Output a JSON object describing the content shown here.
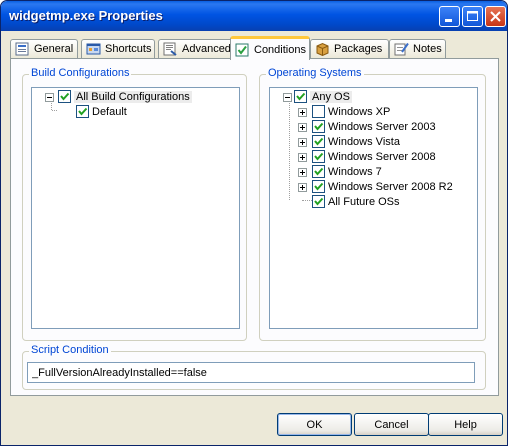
{
  "window": {
    "title": "widgetmp.exe Properties"
  },
  "tabs": [
    {
      "label": "General",
      "icon": "general-icon",
      "active": false
    },
    {
      "label": "Shortcuts",
      "icon": "shortcuts-icon",
      "active": false
    },
    {
      "label": "Advanced",
      "icon": "advanced-icon",
      "active": false
    },
    {
      "label": "Conditions",
      "icon": "conditions-icon",
      "active": true
    },
    {
      "label": "Packages",
      "icon": "packages-icon",
      "active": false
    },
    {
      "label": "Notes",
      "icon": "notes-icon",
      "active": false
    }
  ],
  "build_configurations": {
    "group_label": "Build Configurations",
    "root": {
      "label": "All Build Configurations",
      "checked": true,
      "expanded": true
    },
    "children": [
      {
        "label": "Default",
        "checked": true
      }
    ]
  },
  "operating_systems": {
    "group_label": "Operating Systems",
    "root": {
      "label": "Any OS",
      "checked": true,
      "expanded": true
    },
    "children": [
      {
        "label": "Windows XP",
        "checked": false,
        "expandable": true
      },
      {
        "label": "Windows Server 2003",
        "checked": true,
        "expandable": true
      },
      {
        "label": "Windows Vista",
        "checked": true,
        "expandable": true
      },
      {
        "label": "Windows Server 2008",
        "checked": true,
        "expandable": true
      },
      {
        "label": "Windows 7",
        "checked": true,
        "expandable": true
      },
      {
        "label": "Windows Server 2008 R2",
        "checked": true,
        "expandable": true
      },
      {
        "label": "All Future OSs",
        "checked": true,
        "expandable": false
      }
    ]
  },
  "script_condition": {
    "group_label": "Script Condition",
    "value": "_FullVersionAlreadyInstalled==false"
  },
  "buttons": {
    "ok": "OK",
    "cancel": "Cancel",
    "help": "Help"
  },
  "colors": {
    "titlebar": "#0054e3",
    "group_label": "#0046d5",
    "active_tab_accent": "#ffc83c",
    "dialog_bg": "#ece9d8"
  }
}
